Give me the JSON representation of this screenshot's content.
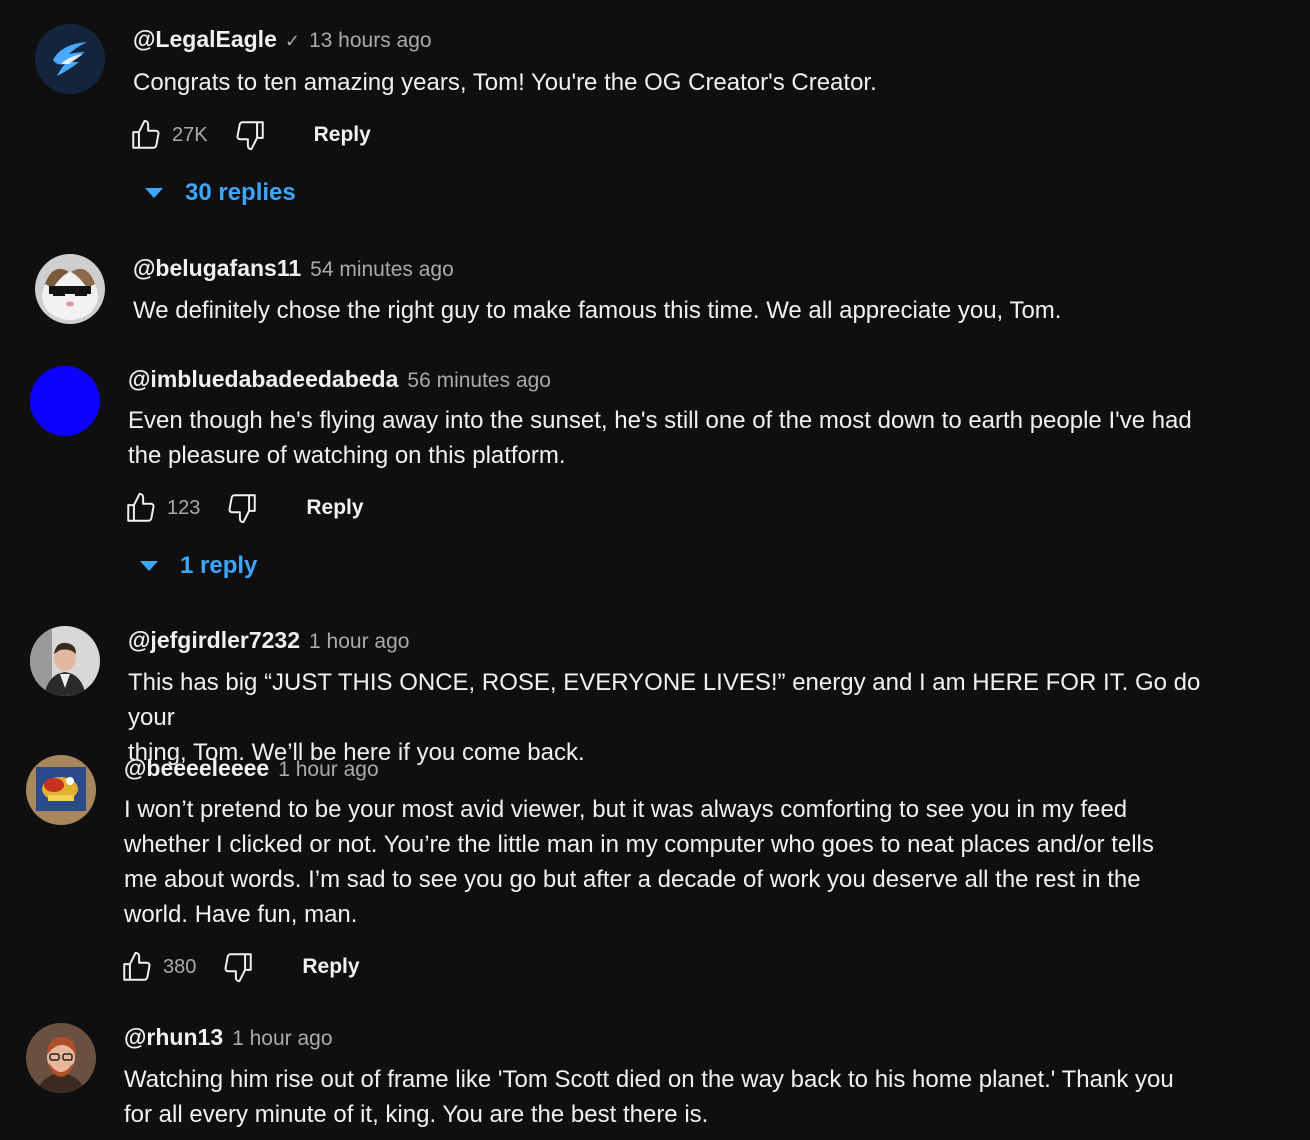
{
  "comments": [
    {
      "author": "@LegalEagle",
      "verified": true,
      "time": "13 hours ago",
      "text_lines": [
        "Congrats to ten amazing years, Tom!  You're the OG Creator's Creator."
      ],
      "likes": "27K",
      "reply_label": "Reply",
      "replies_label": "30 replies"
    },
    {
      "author": "@belugafans11",
      "time": "54 minutes ago",
      "text_lines": [
        "We definitely chose the right guy to make famous this time. We all appreciate you, Tom."
      ]
    },
    {
      "author": "@imbluedabadeedabeda",
      "time": "56 minutes ago",
      "text_lines": [
        "Even though he's flying away into the sunset, he's still one of the most down to earth people I've had",
        "the pleasure of watching on this platform."
      ],
      "likes": "123",
      "reply_label": "Reply",
      "replies_label": "1 reply"
    },
    {
      "author": "@jefgirdler7232",
      "time": "1 hour ago",
      "text_lines": [
        "This has big “JUST THIS ONCE, ROSE, EVERYONE LIVES!” energy and I am HERE FOR IT. Go do your",
        "thing, Tom. We’ll be here if you come back."
      ]
    },
    {
      "author": "@beeeeleeee",
      "time": "1 hour ago",
      "text_lines": [
        "I won’t pretend to be your most avid viewer, but it was always comforting to see you in my feed",
        "whether I clicked or not. You’re the little man in my computer who goes to neat places and/or tells",
        "me about words. I’m sad to see you go but after a decade of work you deserve all the rest in the",
        "world. Have fun, man."
      ],
      "likes": "380",
      "reply_label": "Reply"
    },
    {
      "author": "@rhun13",
      "time": "1 hour ago",
      "text_lines": [
        "Watching him rise out of frame like 'Tom Scott died on the way back to his home planet.' Thank you",
        "for all every minute of it, king. You are the best there is."
      ]
    }
  ],
  "colors": {
    "background": "#0f0f0f",
    "text": "#f1f1f1",
    "secondary_text": "#aaaaaa",
    "link_blue": "#3ea6ff",
    "legaleagle_avatar_bg": "#13243f",
    "blue_avatar": "#0d00ff"
  },
  "icons": [
    "verified-check-icon",
    "thumbs-up-icon",
    "thumbs-down-icon",
    "caret-down-icon"
  ]
}
